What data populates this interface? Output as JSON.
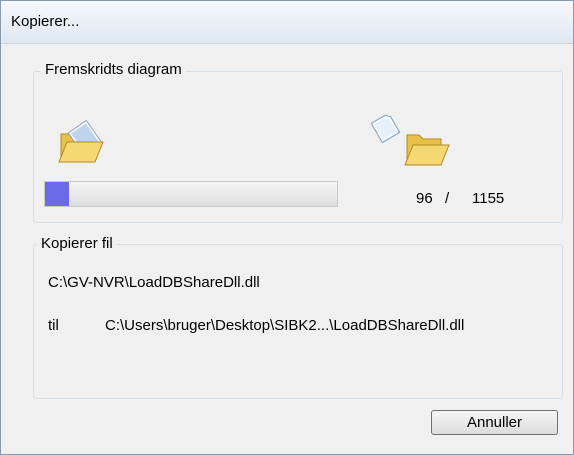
{
  "window": {
    "title": "Kopierer..."
  },
  "progress_group": {
    "legend": "Fremskridts diagram",
    "current": "96",
    "separator": "/",
    "total": "1155",
    "fraction": 0.083
  },
  "copy_group": {
    "legend": "Kopierer fil",
    "source_path": "C:\\GV-NVR\\LoadDBShareDll.dll",
    "to_label": "til",
    "destination_path": "C:\\Users\\bruger\\Desktop\\SIBK2...\\LoadDBShareDll.dll"
  },
  "buttons": {
    "cancel_label": "Annuller"
  },
  "icons": {
    "source": "folder-with-document-icon",
    "destination": "folder-with-flying-paper-icon"
  },
  "colors": {
    "progress_fill": "#6a6ae8",
    "folder": "#f4d470"
  }
}
